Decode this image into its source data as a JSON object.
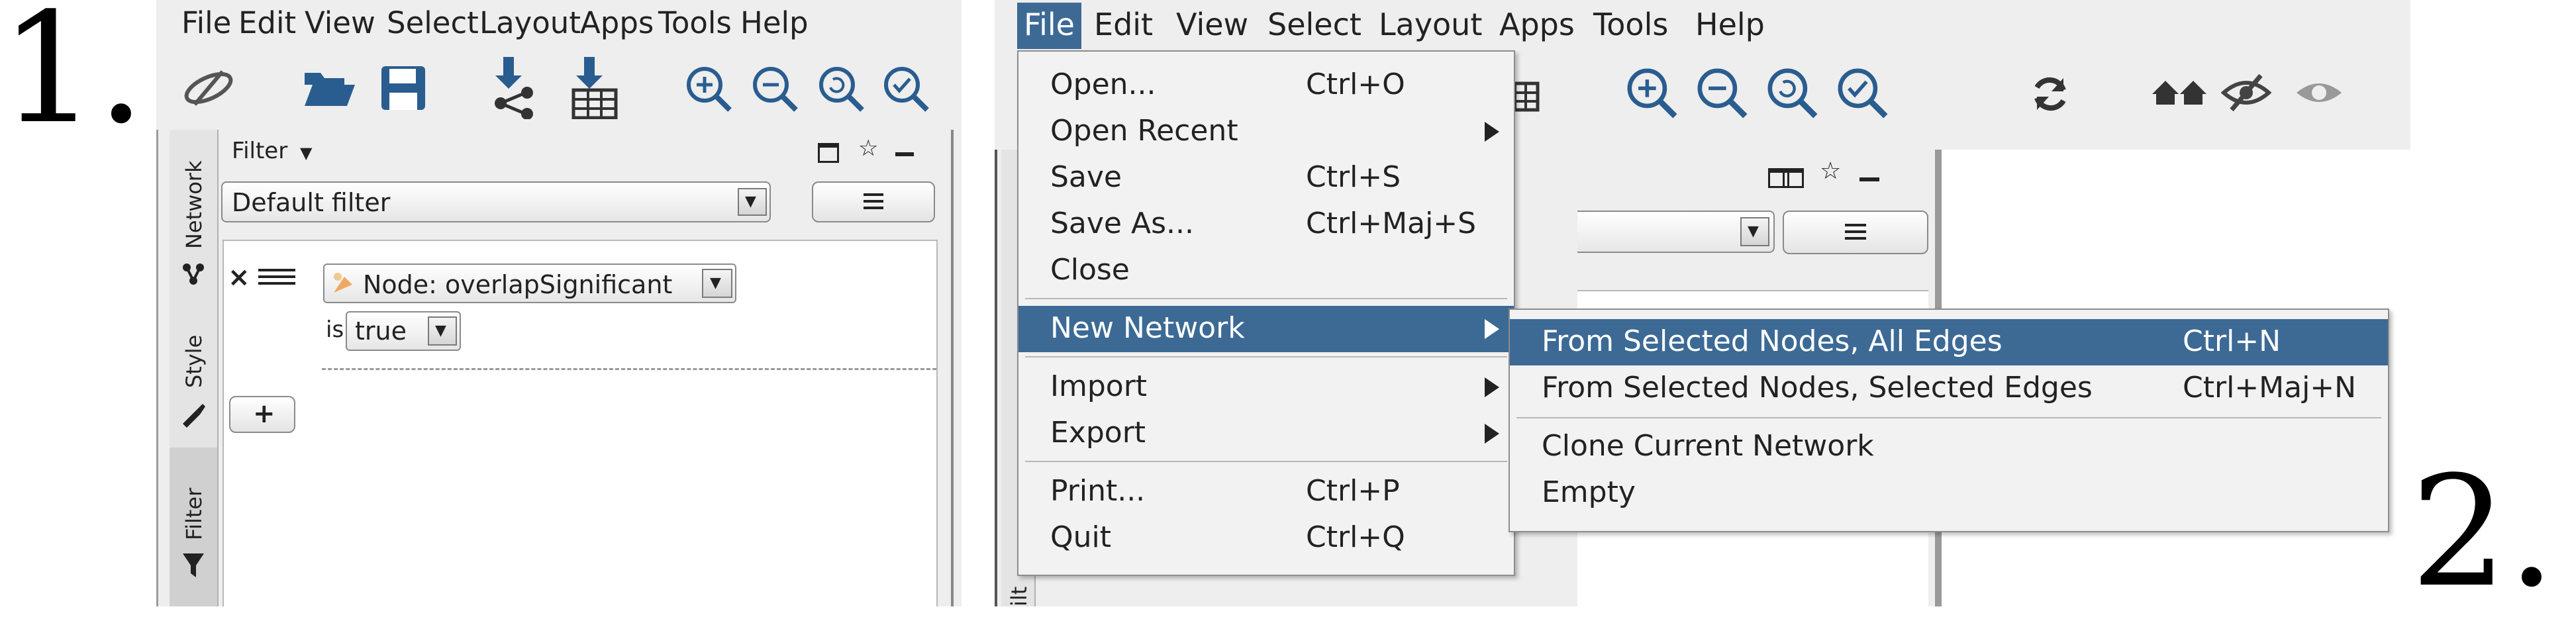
{
  "step_labels": {
    "first": "1.",
    "second": "2."
  },
  "panel1": {
    "menubar": [
      "File",
      "Edit",
      "View",
      "Select",
      "Layout",
      "Apps",
      "Tools",
      "Help"
    ],
    "sidebar_tabs": [
      "Network",
      "Style",
      "Filter"
    ],
    "filter_header": "Filter",
    "filter_select_value": "Default filter",
    "node_condition": "Node: overlapSignificant",
    "is_label": "is",
    "is_value": "true",
    "add_button": "+"
  },
  "panel2": {
    "menubar": [
      "File",
      "Edit",
      "View",
      "Select",
      "Layout",
      "Apps",
      "Tools",
      "Help"
    ],
    "partial_tab": "ilt",
    "file_menu": [
      {
        "label": "Open...",
        "shortcut": "Ctrl+O"
      },
      {
        "label": "Open Recent",
        "shortcut": ""
      },
      {
        "label": "Save",
        "shortcut": "Ctrl+S"
      },
      {
        "label": "Save As...",
        "shortcut": "Ctrl+Maj+S"
      },
      {
        "label": "Close",
        "shortcut": ""
      },
      {
        "label": "New Network",
        "shortcut": ""
      },
      {
        "label": "Import",
        "shortcut": ""
      },
      {
        "label": "Export",
        "shortcut": ""
      },
      {
        "label": "Print...",
        "shortcut": "Ctrl+P"
      },
      {
        "label": "Quit",
        "shortcut": "Ctrl+Q"
      }
    ],
    "new_network_submenu": [
      {
        "label": "From Selected Nodes, All Edges",
        "shortcut": "Ctrl+N"
      },
      {
        "label": "From Selected Nodes, Selected Edges",
        "shortcut": "Ctrl+Maj+N"
      },
      {
        "label": "Clone Current Network",
        "shortcut": ""
      },
      {
        "label": "Empty",
        "shortcut": ""
      }
    ]
  },
  "colors": {
    "menu_highlight": "#3c6a95",
    "toolbar_blue": "#2a5d8f",
    "panel_background": "#eeeeee"
  }
}
